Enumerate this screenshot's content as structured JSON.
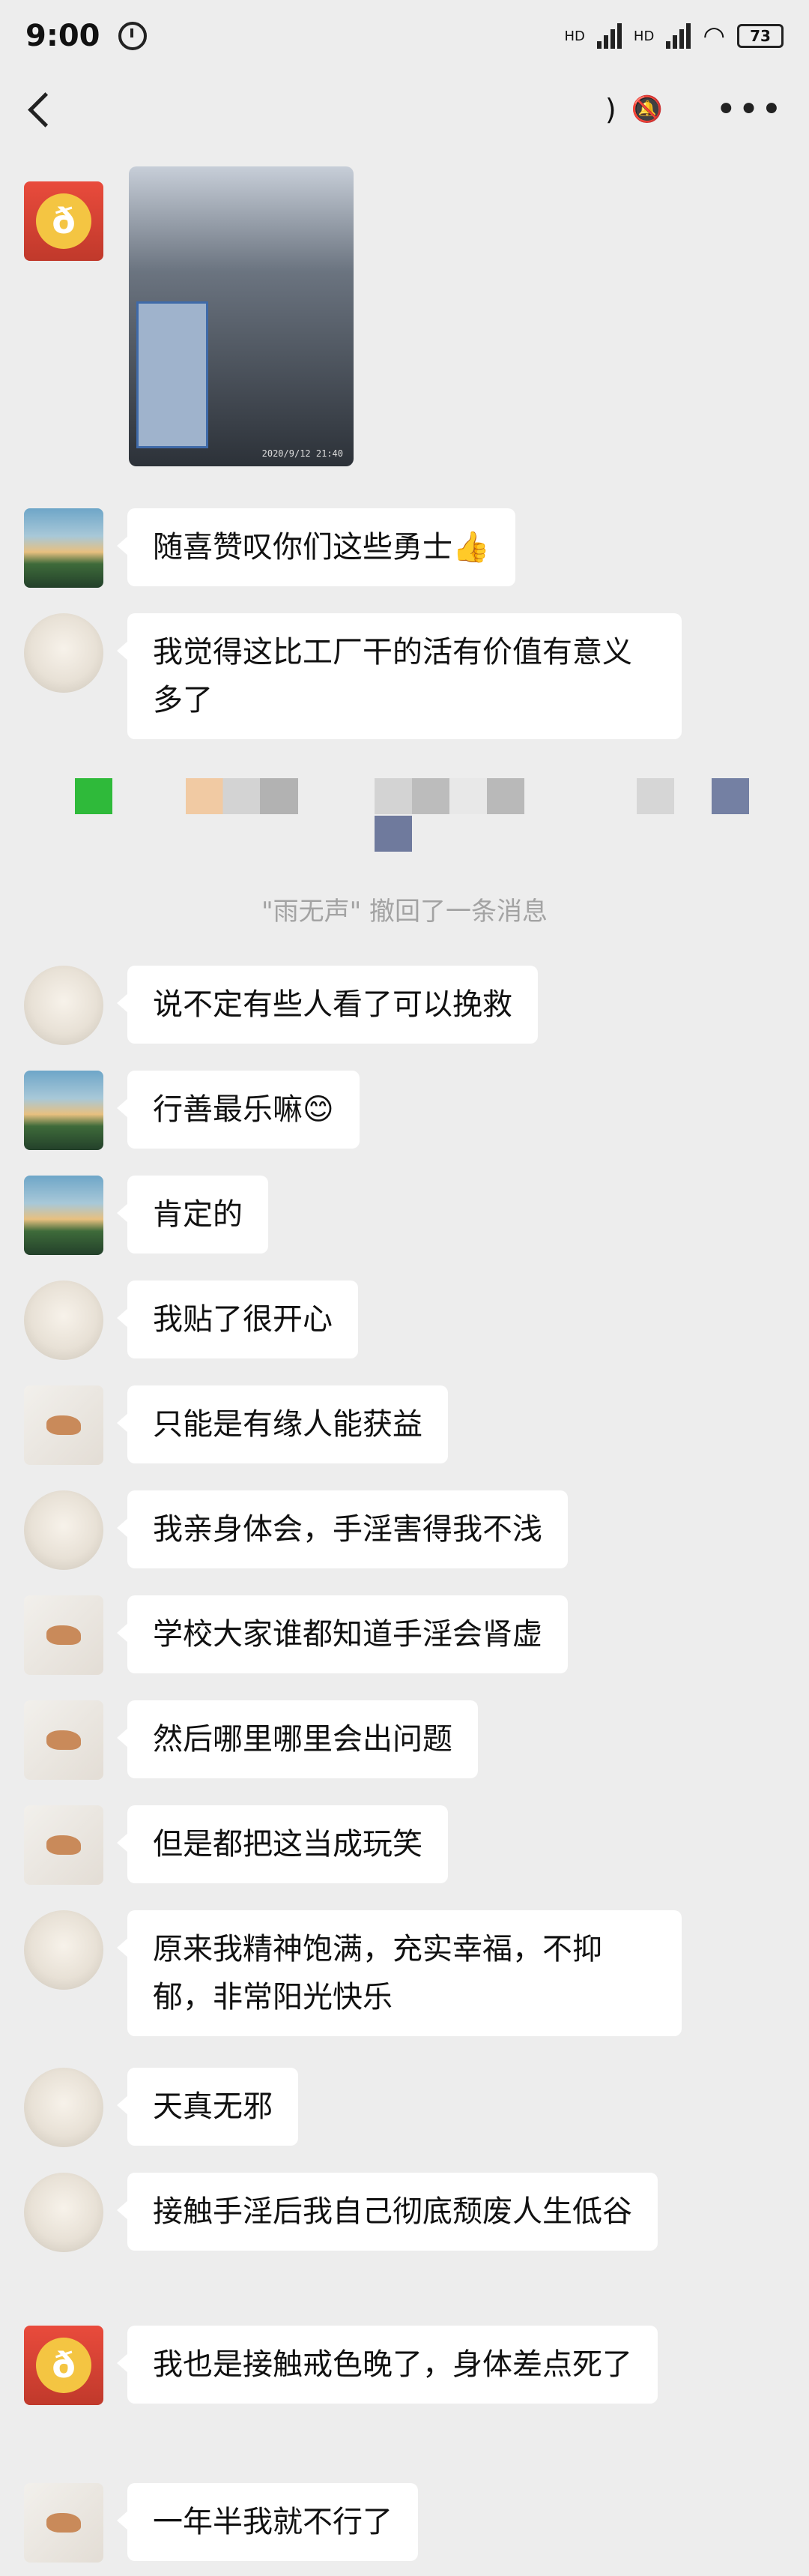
{
  "status": {
    "time": "9:00",
    "battery": "73",
    "hd1": "HD",
    "hd2": "HD"
  },
  "nav": {
    "title": ")"
  },
  "photo": {
    "timestamp": "2020/9/12  21:40"
  },
  "system": {
    "recall": "\"雨无声\" 撤回了一条消息"
  },
  "messages": [
    {
      "avatar": "landscape",
      "text": "随喜赞叹你们这些勇士👍"
    },
    {
      "avatar": "monk",
      "text": "我觉得这比工厂干的活有价值有意义多了"
    },
    {
      "avatar": "monk",
      "text": "说不定有些人看了可以挽救"
    },
    {
      "avatar": "landscape",
      "text": "行善最乐嘛😊"
    },
    {
      "avatar": "landscape",
      "text": "肯定的"
    },
    {
      "avatar": "monk",
      "text": "我贴了很开心"
    },
    {
      "avatar": "deer",
      "text": "只能是有缘人能获益"
    },
    {
      "avatar": "monk",
      "text": "我亲身体会，手淫害得我不浅"
    },
    {
      "avatar": "deer",
      "text": "学校大家谁都知道手淫会肾虚"
    },
    {
      "avatar": "deer",
      "text": "然后哪里哪里会出问题"
    },
    {
      "avatar": "deer",
      "text": "但是都把这当成玩笑"
    },
    {
      "avatar": "monk",
      "text": "原来我精神饱满，充实幸福，不抑郁，非常阳光快乐"
    },
    {
      "avatar": "monk",
      "text": "天真无邪"
    },
    {
      "avatar": "monk",
      "text": "接触手淫后我自己彻底颓废人生低谷"
    },
    {
      "avatar": "buddha",
      "text": "我也是接触戒色晚了，身体差点死了"
    },
    {
      "avatar": "deer",
      "text": "一年半我就不行了"
    }
  ]
}
